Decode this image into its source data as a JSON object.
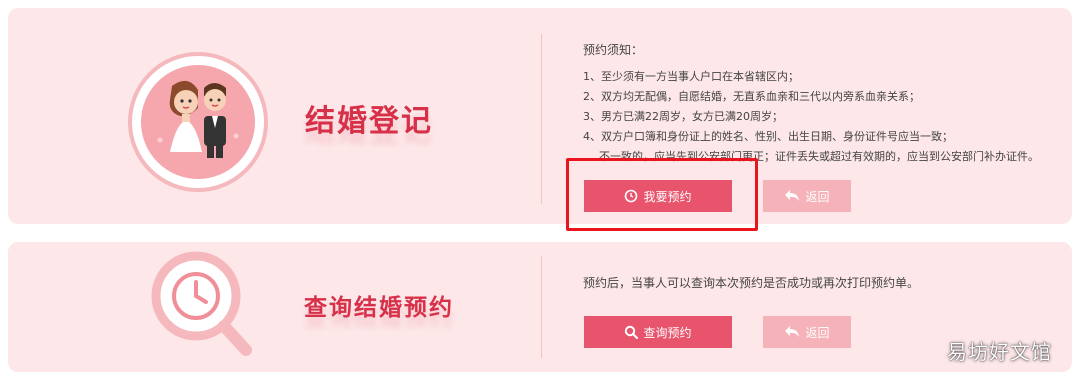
{
  "marriage_registration": {
    "title": "结婚登记",
    "notice_title": "预约须知：",
    "notice_items": [
      "1、至少须有一方当事人户口在本省辖区内；",
      "2、双方均无配偶，自愿结婚，无直系血亲和三代以内旁系血亲关系；",
      "3、男方已满22周岁，女方已满20周岁；",
      "4、双方户口簿和身份证上的姓名、性别、出生日期、身份证件号应当一致；",
      "不一致的，应当先到公安部门更正；证件丢失或超过有效期的，应当到公安部门补办证件。"
    ],
    "reserve_button": "我要预约",
    "back_button": "返回"
  },
  "query_reservation": {
    "title": "查询结婚预约",
    "description": "预约后，当事人可以查询本次预约是否成功或再次打印预约单。",
    "query_button": "查询预约",
    "back_button": "返回"
  },
  "watermark": "易坊好文馆",
  "colors": {
    "panel_bg": "#fde7e8",
    "title": "#d7314a",
    "primary_button": "#e8546c",
    "back_button": "#f5b2b8",
    "highlight": "#e8141e"
  }
}
